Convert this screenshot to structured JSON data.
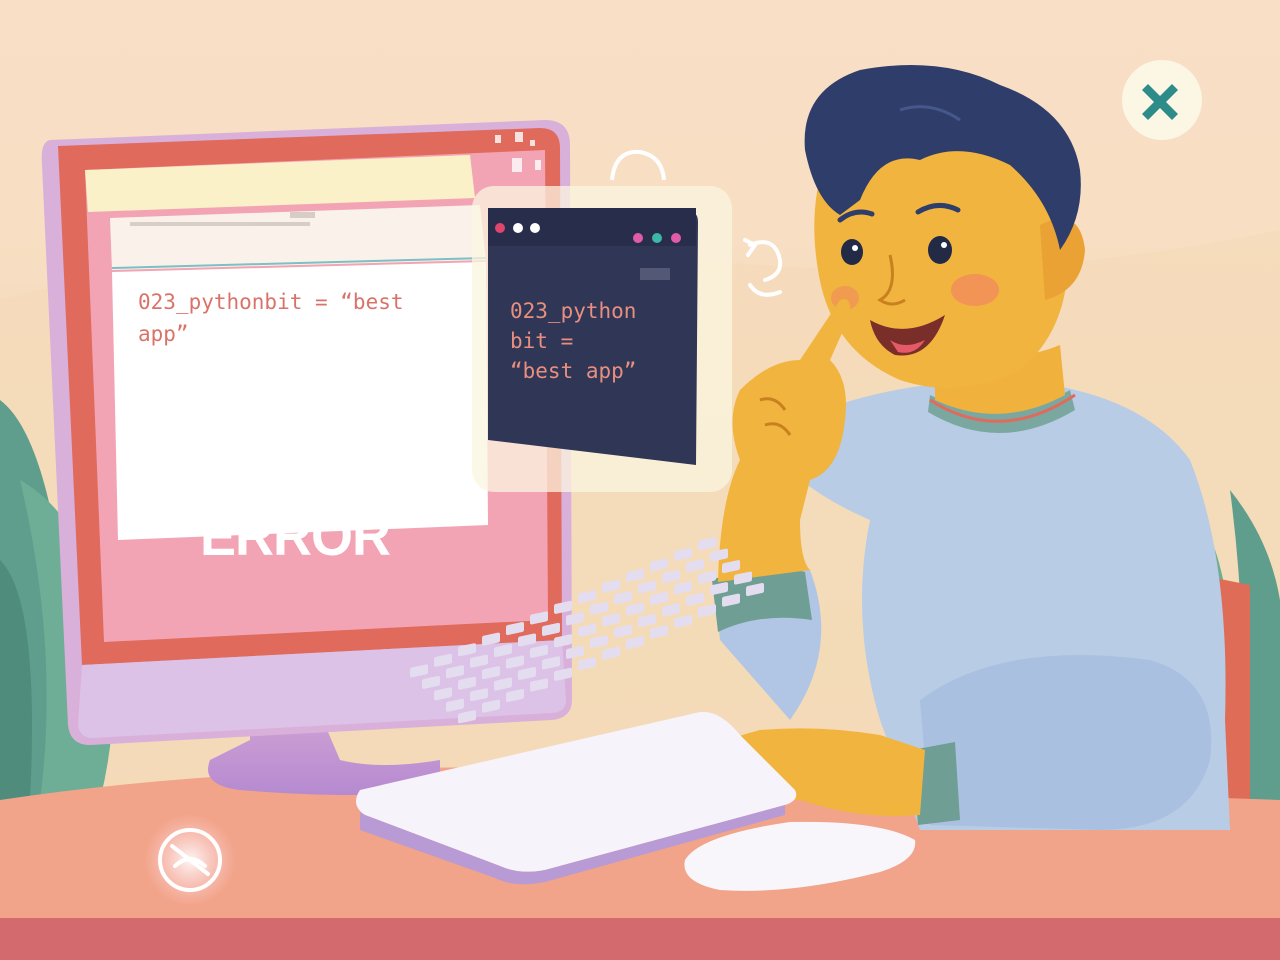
{
  "main_screen": {
    "code_text": "023_pythonbit = “best\napp”",
    "error_label": "ERROR"
  },
  "floating_window": {
    "code_text": "023_python\nbit =\n“best app”"
  },
  "icons": {
    "top_right": "close-x-icon",
    "bottom_left": "no-signal-icon",
    "window_dots": [
      "#e0466c",
      "#ffffff",
      "#ffffff"
    ],
    "right_dots": [
      "#e05ca8",
      "#3bb8a8",
      "#e05ca8"
    ]
  },
  "colors": {
    "background": "#f6dcc0",
    "monitor_frame": "#e06a5c",
    "error_panel": "#f3a4b4",
    "code_text": "#d9736a",
    "dark_window": "#2f3656",
    "sweater": "#b8cce6",
    "desk": "#f2a48a"
  }
}
